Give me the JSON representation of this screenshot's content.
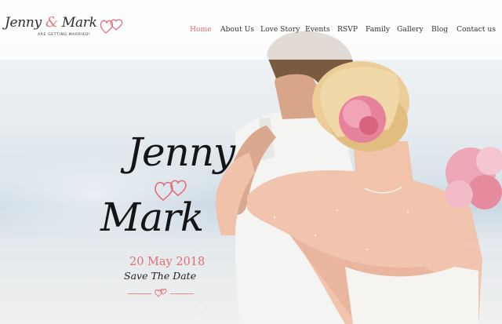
{
  "brand": {
    "name_first": "Jenny",
    "ampersand": "&",
    "name_second": "Mark",
    "tagline": "ARE GETTING MARRIED!"
  },
  "nav": {
    "items": [
      {
        "label": "Home",
        "active": true
      },
      {
        "label": "About Us"
      },
      {
        "label": "Love Story"
      },
      {
        "label": "Events"
      },
      {
        "label": "RSVP"
      },
      {
        "label": "Family"
      },
      {
        "label": "Gallery"
      },
      {
        "label": "Blog"
      },
      {
        "label": "Contact us"
      }
    ]
  },
  "hero": {
    "name_first": "Jenny",
    "name_second": "Mark",
    "date": "20 May 2018",
    "subtitle": "Save The Date"
  },
  "colors": {
    "accent": "#e06d75",
    "text": "#151515"
  }
}
